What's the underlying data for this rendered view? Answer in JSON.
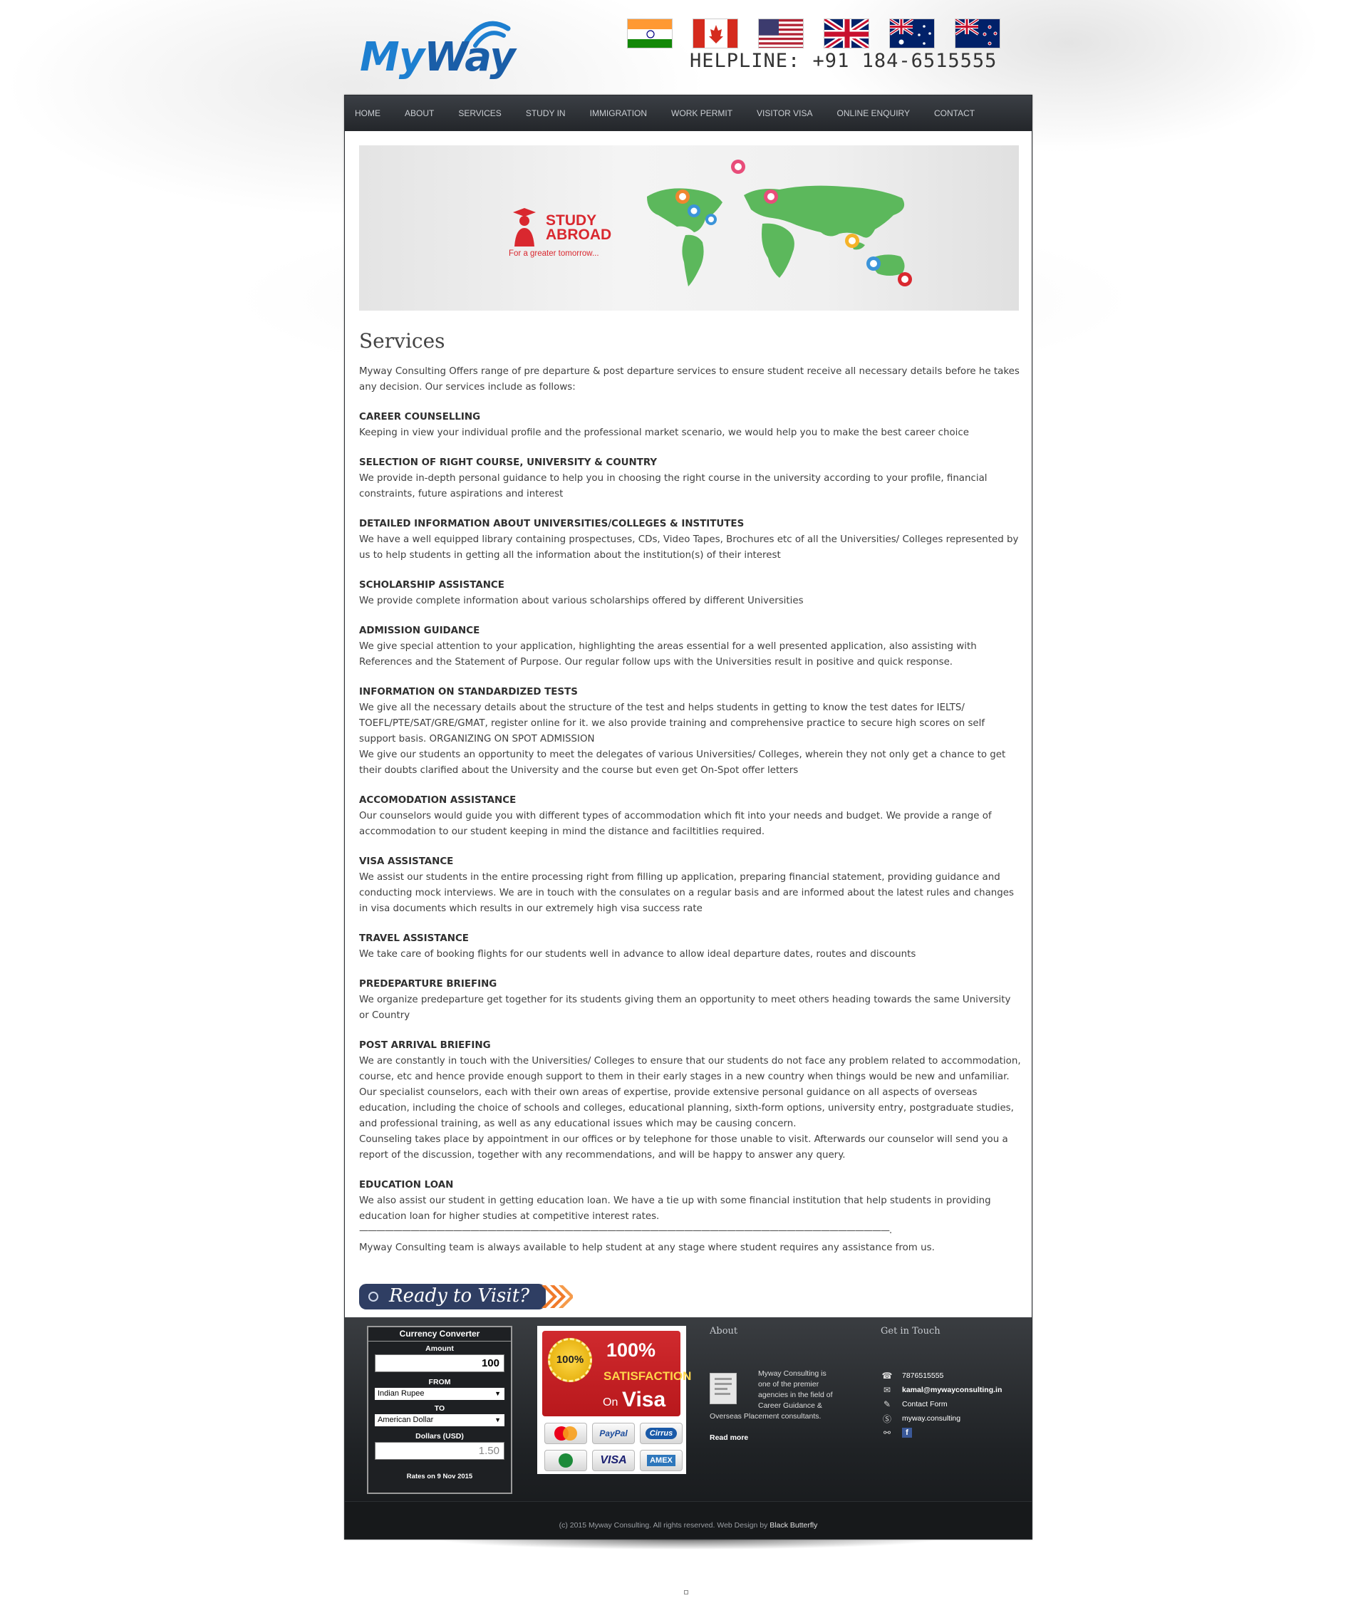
{
  "logo": {
    "part1": "My",
    "part2": "Way"
  },
  "header": {
    "helpline": "HELPLINE: +91 184-6515555",
    "flags": [
      "India",
      "Canada",
      "USA",
      "UK",
      "Australia",
      "New Zealand"
    ]
  },
  "nav": {
    "items": [
      "HOME",
      "ABOUT",
      "SERVICES",
      "STUDY IN",
      "IMMIGRATION",
      "WORK PERMIT",
      "VISITOR VISA",
      "ONLINE ENQUIRY",
      "CONTACT"
    ]
  },
  "banner": {
    "line1": "STUDY",
    "line2": "ABROAD",
    "tagline": "For a greater tomorrow..."
  },
  "content": {
    "title": "Services",
    "intro": "Myway Consulting Offers range of pre departure & post departure services to ensure student receive all necessary details before he takes any decision. Our services include as follows:",
    "sections": [
      {
        "title": "CAREER COUNSELLING",
        "text": "Keeping in view your individual profile and the professional market scenario, we would help you to make the best career choice"
      },
      {
        "title": "SELECTION OF RIGHT COURSE, UNIVERSITY & COUNTRY",
        "text": "We provide in-depth personal guidance to help you in choosing the right course in the university according to your profile, financial constraints, future aspirations and interest"
      },
      {
        "title": "DETAILED INFORMATION ABOUT UNIVERSITIES/COLLEGES & INSTITUTES",
        "text": "We have a well equipped library containing prospectuses, CDs, Video Tapes, Brochures etc of all the Universities/ Colleges represented by us to help students in getting all the information about the institution(s) of their interest"
      },
      {
        "title": "SCHOLARSHIP ASSISTANCE",
        "text": "We provide complete information about various scholarships offered by different Universities"
      },
      {
        "title": "ADMISSION GUIDANCE",
        "text": "We give special attention to your application, highlighting the areas essential for a well presented application, also assisting with References and the Statement of Purpose. Our regular follow ups with the Universities result in positive and quick response."
      },
      {
        "title": "INFORMATION ON STANDARDIZED TESTS",
        "text": "We give all the necessary details about the structure of the test and helps students in getting to know the test dates for IELTS/ TOEFL/PTE/SAT/GRE/GMAT, register online for it. we also provide training and comprehensive practice to secure high scores on self support basis. ORGANIZING ON SPOT ADMISSION",
        "text2": "We give our students an opportunity to meet the delegates of various Universities/ Colleges, wherein they not only get a chance to get their doubts clarified about the University and the course but even get On-Spot offer letters"
      },
      {
        "title": "ACCOMODATION ASSISTANCE",
        "text": "Our counselors would guide you with different types of accommodation which fit into your needs and budget. We provide a range of accommodation to our student keeping in mind the distance and faciltitlies required."
      },
      {
        "title": "VISA ASSISTANCE",
        "text": "We assist our students in the entire processing right from filling up application, preparing financial statement, providing guidance and conducting mock interviews. We are in touch with the consulates on a regular basis and are informed about the latest rules and changes in visa documents which results in our extremely high visa success rate"
      },
      {
        "title": "TRAVEL ASSISTANCE",
        "text": "We take care of booking flights for our students well in advance to allow ideal departure dates, routes and discounts"
      },
      {
        "title": "PREDEPARTURE BRIEFING",
        "text": "We organize predeparture get together for its students giving them an opportunity to meet others heading towards the same University or Country"
      },
      {
        "title": "POST ARRIVAL BRIEFING",
        "text": "We are constantly in touch with the Universities/ Colleges to ensure that our students do not face any problem related to accommodation, course, etc and hence provide enough support to them in their early stages in a new country when things would be new and unfamiliar. Our specialist counselors, each with their own areas of expertise, provide extensive personal guidance on all aspects of overseas education, including the choice of schools and colleges, educational planning, sixth-form options, university entry, postgraduate studies, and professional training, as well as any educational issues which may be causing concern.",
        "text2": "Counseling takes place by appointment in our offices or by telephone for those unable to visit. Afterwards our counselor will send you a report of the discussion, together with any recommendations, and will be happy to answer any query."
      },
      {
        "title": "EDUCATION LOAN",
        "text": "We also assist our student in getting education loan. We have a tie up with some financial institution that help students in providing education loan for higher studies at competitive interest rates."
      }
    ],
    "dashes": "——————————————————————————————————————————————————————————————.",
    "closing": "Myway Consulting team is always available to help student at any stage where student requires any assistance from us.",
    "ready": "Ready to Visit?"
  },
  "footer": {
    "converter": {
      "title": "Currency Converter",
      "amount_label": "Amount",
      "amount_value": "100",
      "from_label": "FROM",
      "from_value": "Indian Rupee",
      "to_label": "TO",
      "to_value": "American Dollar",
      "result_label": "Dollars (USD)",
      "result_value": "1.50",
      "rates": "Rates on 9 Nov 2015"
    },
    "badge": {
      "seal": "100%",
      "pct": "100%",
      "line1": "SATISFACTION",
      "on": "On",
      "visa": "Visa",
      "cards": [
        "MasterCard",
        "PayPal",
        "Cirrus",
        "Discover",
        "VISA",
        "AMEX"
      ]
    },
    "about": {
      "title": "About",
      "text": "Myway Consulting is one of the premier agencies in the field of Career Guidance &",
      "text2": "Overseas Placement consultants.",
      "readmore": "Read more"
    },
    "contact": {
      "title": "Get in Touch",
      "phone": "7876515555",
      "email": "kamal@mywayconsulting.in",
      "form": "Contact Form",
      "skype": "myway.consulting",
      "fb": "f"
    },
    "copyright": {
      "prefix": "(c) 2015 Myway Consulting. All rights reserved. Web Design by ",
      "author": "Black Butterfly"
    }
  },
  "colors": {
    "brand": "#1d7fd0",
    "nav_bg": "#2c2f33",
    "banner_red": "#d9282f",
    "map_green": "#5cb85c"
  }
}
